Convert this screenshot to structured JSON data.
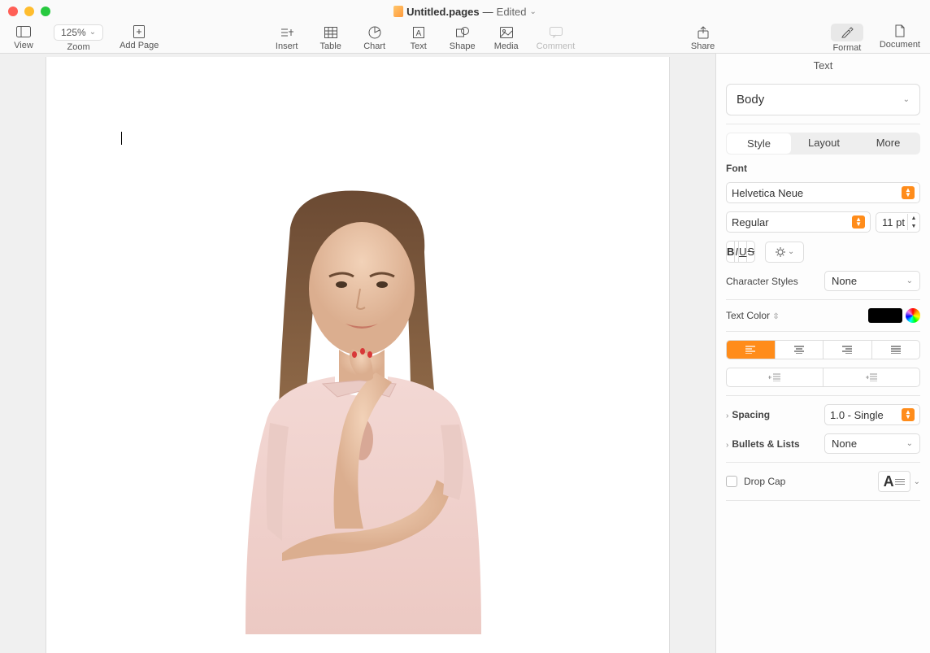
{
  "title": {
    "doc_name": "Untitled.pages",
    "separator": "—",
    "status": "Edited"
  },
  "toolbar": {
    "view": "View",
    "zoom_value": "125%",
    "zoom": "Zoom",
    "add_page": "Add Page",
    "insert": "Insert",
    "table": "Table",
    "chart": "Chart",
    "text": "Text",
    "shape": "Shape",
    "media": "Media",
    "comment": "Comment",
    "share": "Share",
    "format": "Format",
    "document": "Document"
  },
  "inspector": {
    "tab_label": "Text",
    "paragraph_style": "Body",
    "seg": {
      "style": "Style",
      "layout": "Layout",
      "more": "More"
    },
    "font_heading": "Font",
    "font_family": "Helvetica Neue",
    "font_weight": "Regular",
    "font_size": "11 pt",
    "bius": {
      "b": "B",
      "i": "I",
      "u": "U",
      "s": "S"
    },
    "char_styles_label": "Character Styles",
    "char_styles_value": "None",
    "text_color_label": "Text Color",
    "spacing_label": "Spacing",
    "spacing_value": "1.0 - Single",
    "bullets_label": "Bullets & Lists",
    "bullets_value": "None",
    "dropcap_label": "Drop Cap"
  },
  "colors": {
    "accent": "#ff8c1a",
    "text_color": "#000000"
  }
}
